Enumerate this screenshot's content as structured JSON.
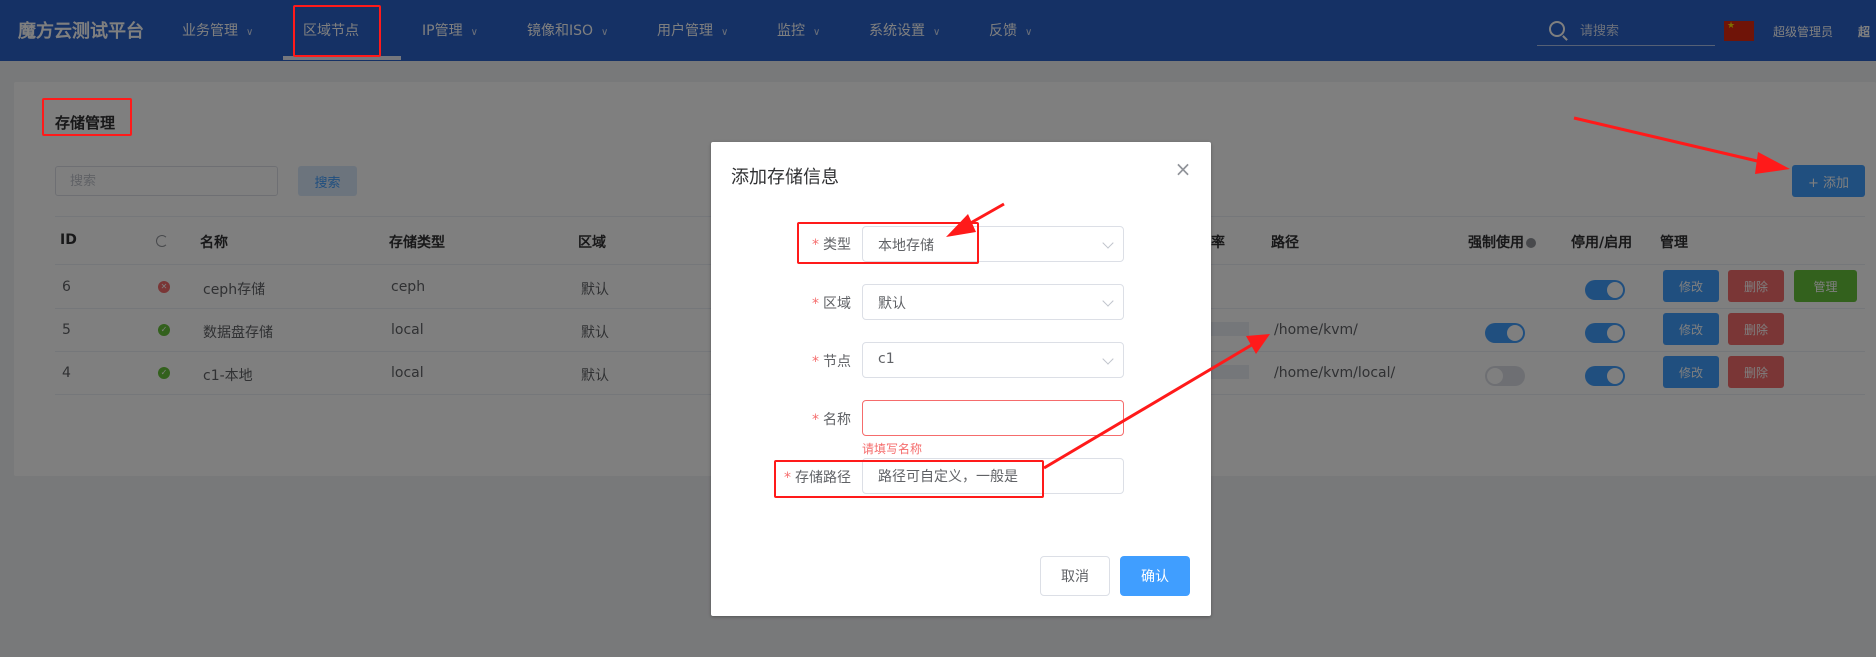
{
  "header": {
    "brand": "魔方云测试平台",
    "nav": [
      {
        "label": "业务管理"
      },
      {
        "label": "区域节点"
      },
      {
        "label": "IP管理"
      },
      {
        "label": "镜像和ISO"
      },
      {
        "label": "用户管理"
      },
      {
        "label": "监控"
      },
      {
        "label": "系统设置"
      },
      {
        "label": "反馈"
      }
    ],
    "search_placeholder": "请搜索",
    "username": "超级管理员",
    "username_cut": "超"
  },
  "page": {
    "title": "存储管理",
    "search_placeholder": "搜索",
    "search_label": "搜索",
    "add_label": "+ 添加"
  },
  "table": {
    "headers": {
      "id": "ID",
      "name": "名称",
      "type": "存储类型",
      "zone": "区域",
      "rate_partial": "率",
      "path": "路径",
      "force": "强制使用",
      "toggle": "停用/启用",
      "manage": "管理"
    },
    "rows": [
      {
        "id": "6",
        "status": "error",
        "name": "ceph存储",
        "type": "ceph",
        "zone": "默认",
        "path": "",
        "force_on": null,
        "enabled": true
      },
      {
        "id": "5",
        "status": "ok",
        "name": "数据盘存储",
        "type": "local",
        "zone": "默认",
        "path": "/home/kvm/",
        "force_on": true,
        "enabled": true
      },
      {
        "id": "4",
        "status": "ok",
        "name": "c1-本地",
        "type": "local",
        "zone": "默认",
        "path": "/home/kvm/local/",
        "force_on": false,
        "enabled": true
      }
    ],
    "ops": {
      "edit": "修改",
      "delete": "删除",
      "manage": "管理"
    }
  },
  "dialog": {
    "title": "添加存储信息",
    "close_glyph": "×",
    "fields": {
      "type_label": "类型",
      "type_value": "本地存储",
      "zone_label": "区域",
      "zone_value": "默认",
      "node_label": "节点",
      "node_value": "c1",
      "name_label": "名称",
      "name_value": "",
      "name_error": "请填写名称",
      "path_label": "存储路径",
      "path_value": "路径可自定义，一般是"
    },
    "required_mark": "*",
    "cancel_label": "取消",
    "confirm_label": "确认"
  },
  "colors": {
    "nav_bg": "#2b62ca",
    "primary": "#409eff",
    "danger": "#f56c6c",
    "success": "#67c23a",
    "annotation": "#ff1a1a"
  }
}
